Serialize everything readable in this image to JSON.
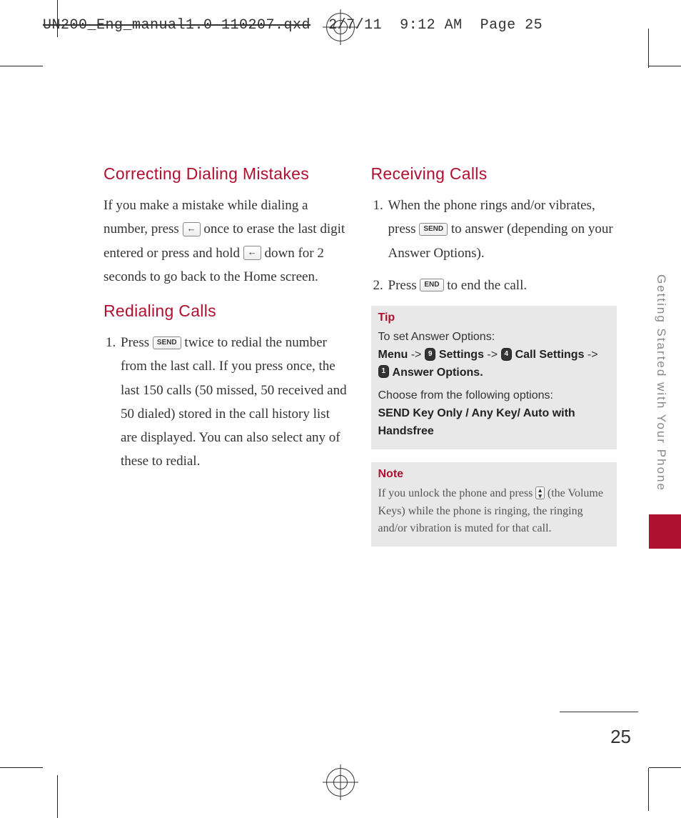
{
  "print_header": {
    "filename_struck": "UN200_Eng_manual1.0-110207.qxd",
    "date": "2/7/11",
    "time": "9:12 AM",
    "page_label": "Page 25"
  },
  "side_tab": "Getting Started with Your Phone",
  "page_number": "25",
  "left_column": {
    "h1": "Correcting Dialing Mistakes",
    "p1a": "If you make a mistake while dialing a number, press ",
    "p1b": " once to erase the last digit entered or press and hold ",
    "p1c": " down for 2 seconds to go back to the Home screen.",
    "h2": "Redialing Calls",
    "li1a": "Press ",
    "li1b": " twice to redial the number from the last call. If you press once, the last 150 calls (50 missed, 50 received and 50 dialed) stored in the call history list are displayed. You can also select any of these to redial."
  },
  "right_column": {
    "h1": "Receiving Calls",
    "li1a": "When the phone rings and/or vibrates, press ",
    "li1b": " to answer (depending on your Answer Options).",
    "li2a": "Press ",
    "li2b": " to end the call.",
    "tip": {
      "title": "Tip",
      "line1": "To set Answer Options:",
      "menu": "Menu",
      "arrow": " -> ",
      "settings": " Settings",
      "call_settings": " Call Settings",
      "answer_options": " Answer Options.",
      "line3": "Choose from the following options:",
      "options": "SEND Key Only / Any Key/ Auto with Handsfree"
    },
    "note": {
      "title": "Note",
      "text_a": "If you unlock the phone and press ",
      "text_b": " (the Volume Keys) while the phone is ringing, the ringing and/or vibration is muted for that call."
    }
  },
  "icons": {
    "back_arrow": "←",
    "send": "SEND",
    "end": "END",
    "key9": "9",
    "key4": "4",
    "key1": "1",
    "vol_up": "▴",
    "vol_down": "▾"
  }
}
